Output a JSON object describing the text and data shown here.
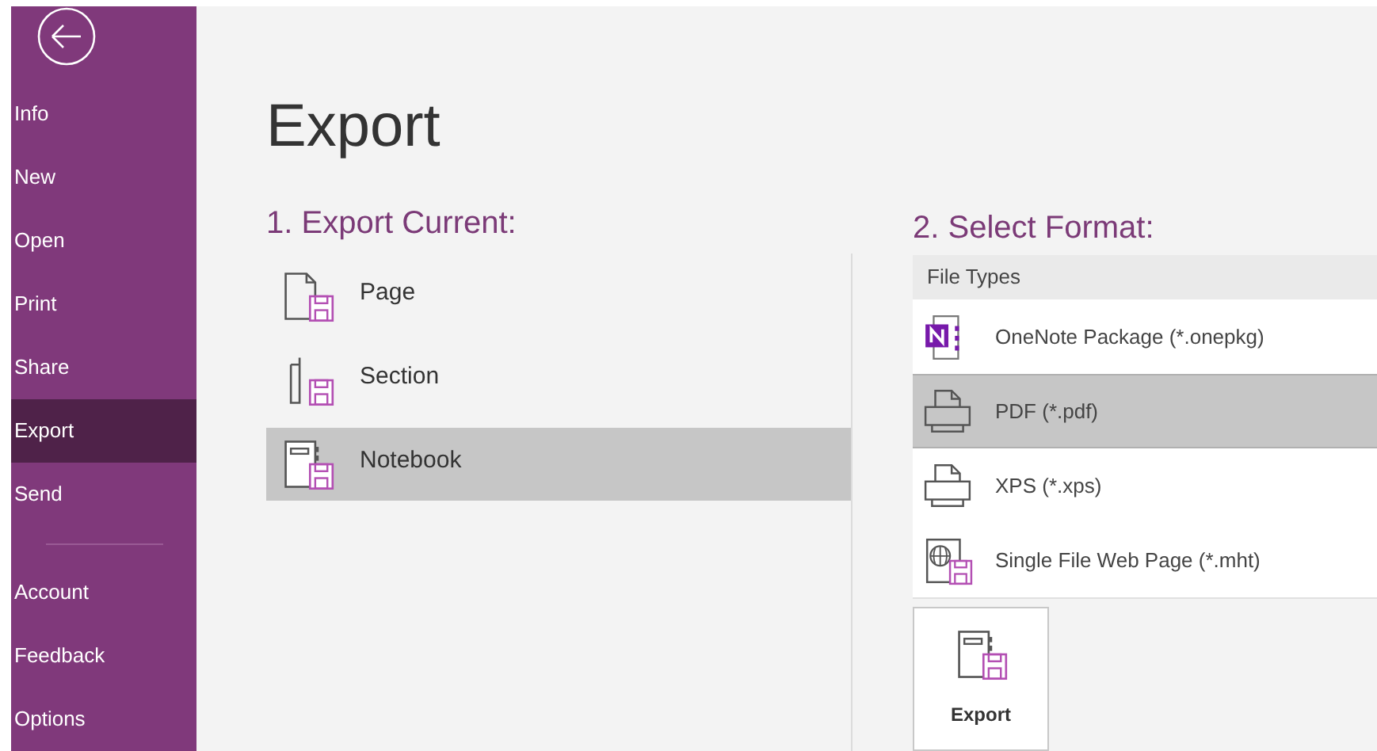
{
  "sidebar": {
    "items": [
      {
        "label": "Info",
        "selected": false
      },
      {
        "label": "New",
        "selected": false
      },
      {
        "label": "Open",
        "selected": false
      },
      {
        "label": "Print",
        "selected": false
      },
      {
        "label": "Share",
        "selected": false
      },
      {
        "label": "Export",
        "selected": true
      },
      {
        "label": "Send",
        "selected": false
      }
    ],
    "footer_items": [
      {
        "label": "Account",
        "selected": false
      },
      {
        "label": "Feedback",
        "selected": false
      },
      {
        "label": "Options",
        "selected": false
      }
    ]
  },
  "title": "Export",
  "export_current": {
    "heading": "1. Export Current:",
    "items": [
      {
        "kind": "page",
        "label": "Page",
        "selected": false
      },
      {
        "kind": "section",
        "label": "Section",
        "selected": false
      },
      {
        "kind": "notebook",
        "label": "Notebook",
        "selected": true
      }
    ]
  },
  "select_format": {
    "heading": "2. Select Format:",
    "list_header": "File Types",
    "items": [
      {
        "kind": "onepkg",
        "label": "OneNote Package (*.onepkg)",
        "selected": false
      },
      {
        "kind": "pdf",
        "label": "PDF (*.pdf)",
        "selected": true
      },
      {
        "kind": "xps",
        "label": "XPS (*.xps)",
        "selected": false
      },
      {
        "kind": "mht",
        "label": "Single File Web Page (*.mht)",
        "selected": false
      }
    ]
  },
  "export_button": {
    "label": "Export"
  }
}
